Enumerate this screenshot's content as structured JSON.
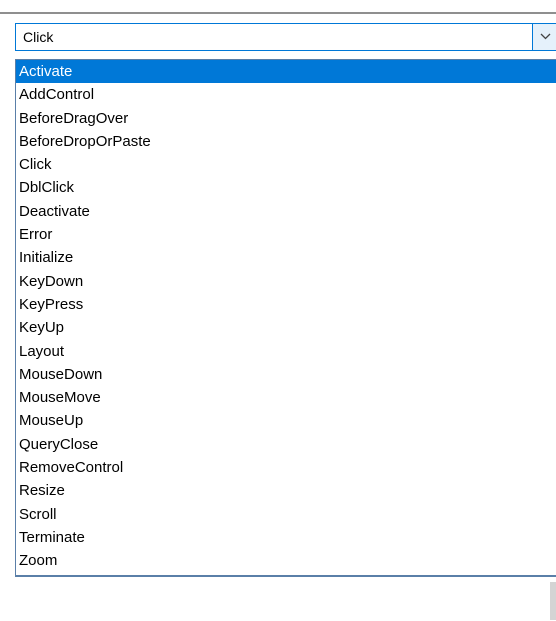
{
  "combo": {
    "selected_value": "Click",
    "dropdown_icon": "chevron-down-icon"
  },
  "dropdown": {
    "selected_index": 0,
    "items": [
      "Activate",
      "AddControl",
      "BeforeDragOver",
      "BeforeDropOrPaste",
      "Click",
      "DblClick",
      "Deactivate",
      "Error",
      "Initialize",
      "KeyDown",
      "KeyPress",
      "KeyUp",
      "Layout",
      "MouseDown",
      "MouseMove",
      "MouseUp",
      "QueryClose",
      "RemoveControl",
      "Resize",
      "Scroll",
      "Terminate",
      "Zoom"
    ]
  },
  "colors": {
    "highlight": "#0078d7",
    "highlight_text": "#ffffff",
    "border": "#0078d7",
    "list_border": "#5a7fa8"
  }
}
